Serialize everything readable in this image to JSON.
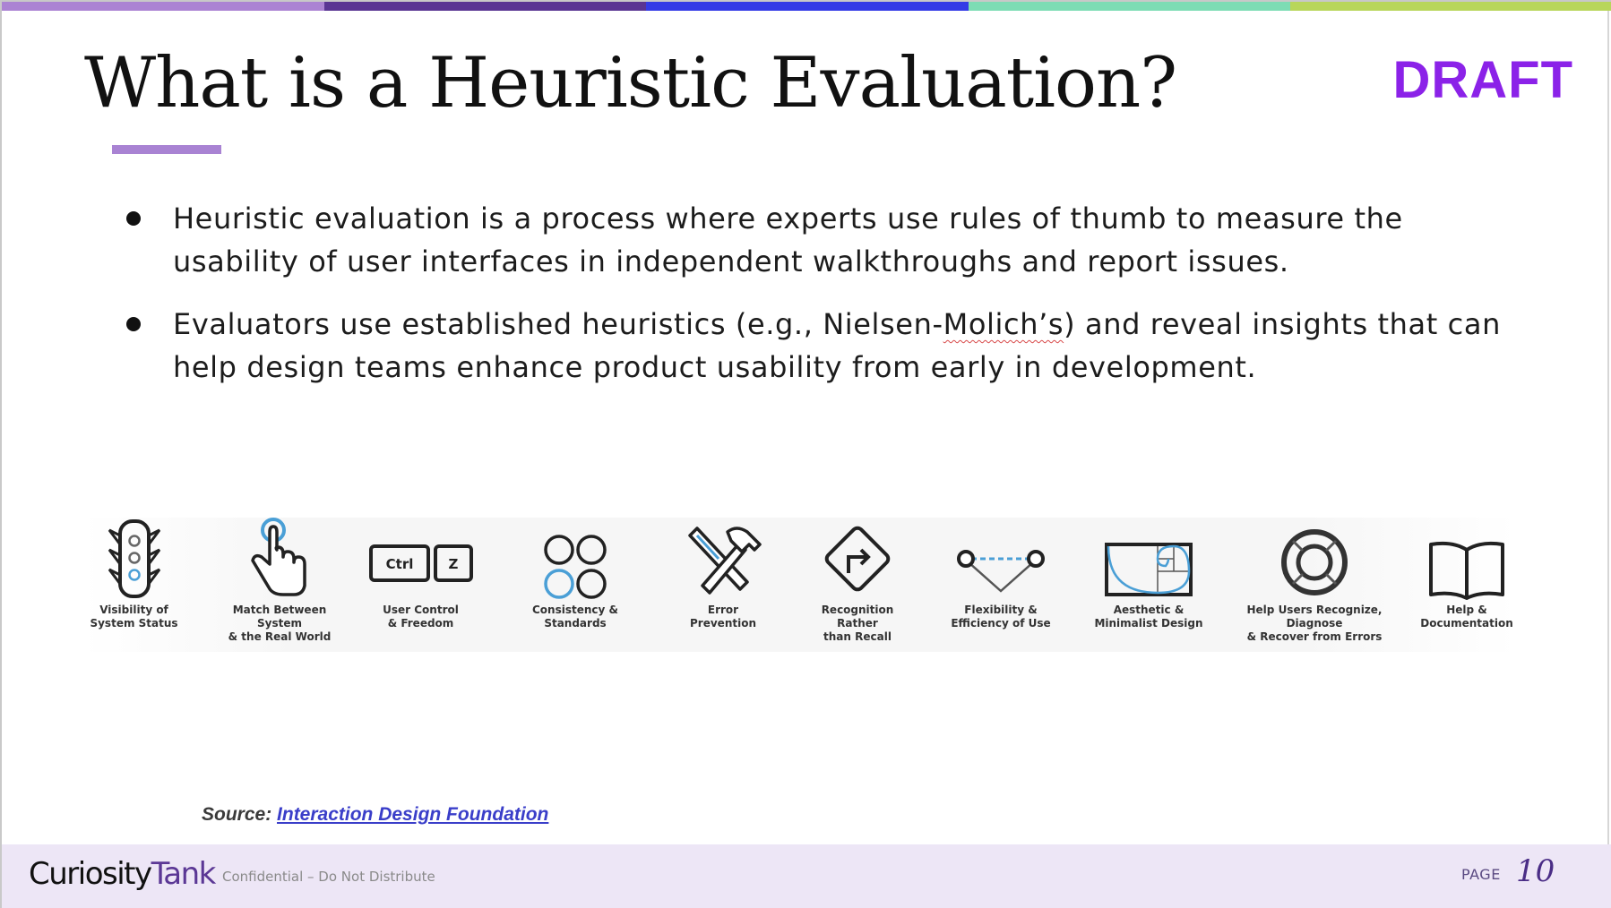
{
  "header": {
    "accent_stripes": [
      "#ab83d3",
      "#5a3593",
      "#343be6",
      "#7ddcb4",
      "#b8d65a"
    ],
    "title": "What is a Heuristic Evaluation?",
    "title_underline_color": "#a983d3",
    "draft_label": "DRAFT",
    "draft_color": "#8b22e8"
  },
  "bullets": [
    {
      "text": "Heuristic evaluation is a process where experts use rules of thumb to measure the usability of user interfaces in independent walkthroughs and report issues."
    },
    {
      "text_before": "Evaluators use established heuristics (e.g., Nielsen-",
      "text_flagged": "Molich’s",
      "text_after": ") and reveal insights that can help design teams enhance product usability from early in development."
    }
  ],
  "heuristics": [
    {
      "icon": "traffic-light-icon",
      "label": "Visibility of\nSystem Status"
    },
    {
      "icon": "pointing-hand-icon",
      "label": "Match Between System\n& the Real World"
    },
    {
      "icon": "ctrl-z-keys-icon",
      "label": "User Control\n& Freedom",
      "key1": "Ctrl",
      "key2": "Z"
    },
    {
      "icon": "four-circles-icon",
      "label": "Consistency & Standards"
    },
    {
      "icon": "hammer-wrench-icon",
      "label": "Error Prevention"
    },
    {
      "icon": "turn-sign-icon",
      "label": "Recognition Rather\nthan Recall"
    },
    {
      "icon": "shortcut-path-icon",
      "label": "Flexibility &\nEfficiency of Use"
    },
    {
      "icon": "golden-ratio-icon",
      "label": "Aesthetic &\nMinimalist Design"
    },
    {
      "icon": "lifebuoy-icon",
      "label": "Help Users Recognize, Diagnose\n& Recover from Errors"
    },
    {
      "icon": "open-book-icon",
      "label": "Help &\nDocumentation"
    }
  ],
  "source": {
    "label": "Source:",
    "link_text": "Interaction Design Foundation"
  },
  "footer": {
    "logo_part1": "Curiosity",
    "logo_part2": "Tank",
    "confidential": "Confidential – Do Not Distribute",
    "page_label": "PAGE",
    "page_number": "10"
  }
}
